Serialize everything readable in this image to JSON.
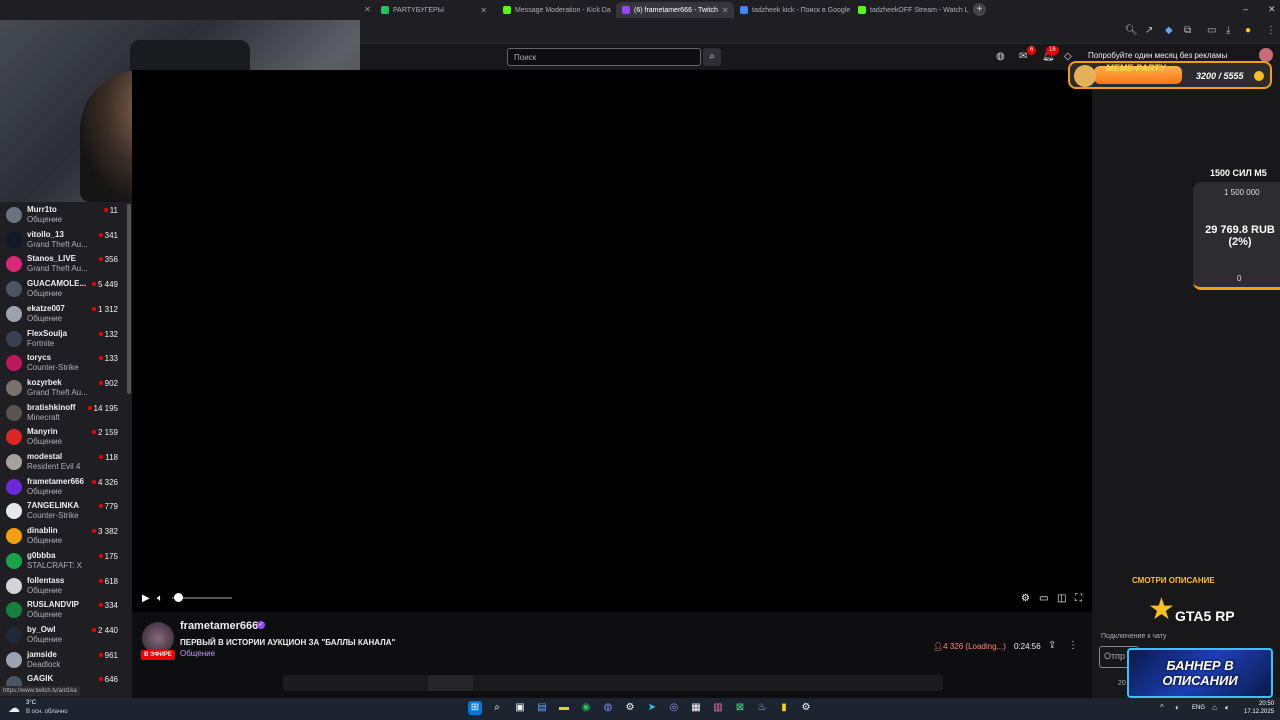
{
  "browser": {
    "tabs": [
      {
        "label": "PARTYБУГЕРЫ",
        "color": "#22c55e"
      },
      {
        "label": "Message Moderation - Kick Da",
        "color": "#53fc18"
      },
      {
        "label": "(6) frametamer666 - Twitch",
        "color": "#9147ff",
        "active": true
      },
      {
        "label": "tadzheek kick - Поиск в Google",
        "color": "#4285f4"
      },
      {
        "label": "tadzheekOFF Stream - Watch L",
        "color": "#53fc18"
      }
    ],
    "new_tab": "+",
    "status_url": "https://www.twitch.tv/ant1ka"
  },
  "twitch": {
    "search_placeholder": "Поиск",
    "notif_inbox_count": "6",
    "notif_count": "16",
    "prime_text": "Попробуйте один месяц без рекламы"
  },
  "sidebar": {
    "channels": [
      {
        "name": "Murr1to",
        "game": "Общение",
        "viewers": "11",
        "color": "#6b7280"
      },
      {
        "name": "vitollo_13",
        "game": "Grand Theft Au...",
        "viewers": "341",
        "color": "#111827"
      },
      {
        "name": "Stanos_LIVE",
        "game": "Grand Theft Au...",
        "viewers": "356",
        "color": "#db2777"
      },
      {
        "name": "GUACAMOLE...",
        "game": "Общение",
        "viewers": "5 449",
        "color": "#4b5563"
      },
      {
        "name": "ekatze007",
        "game": "Общение",
        "viewers": "1 312",
        "color": "#9ca3af"
      },
      {
        "name": "FlexSoulja",
        "game": "Fortnite",
        "viewers": "132",
        "color": "#374151"
      },
      {
        "name": "torycs",
        "game": "Counter-Strike",
        "viewers": "133",
        "color": "#be185d"
      },
      {
        "name": "kozyrbek",
        "game": "Grand Theft Au...",
        "viewers": "902",
        "color": "#78716c"
      },
      {
        "name": "bratishkinoff",
        "game": "Minecraft",
        "viewers": "14 195",
        "color": "#57534e"
      },
      {
        "name": "Manyrin",
        "game": "Общение",
        "viewers": "2 159",
        "color": "#dc2626"
      },
      {
        "name": "modestal",
        "game": "Resident Evil 4",
        "viewers": "118",
        "color": "#a8a29e"
      },
      {
        "name": "frametamer666",
        "game": "Общение",
        "viewers": "4 326",
        "color": "#6d28d9"
      },
      {
        "name": "7ANGELINKA",
        "game": "Counter-Strike",
        "viewers": "779",
        "color": "#e5e7eb"
      },
      {
        "name": "dinablin",
        "game": "Общение",
        "viewers": "3 382",
        "color": "#f59e0b"
      },
      {
        "name": "g0bbba",
        "game": "STALCRAFT: X",
        "viewers": "175",
        "color": "#16a34a"
      },
      {
        "name": "follentass",
        "game": "Общение",
        "viewers": "618",
        "color": "#d1d5db"
      },
      {
        "name": "RUSLANDVIP",
        "game": "Общение",
        "viewers": "334",
        "color": "#15803d"
      },
      {
        "name": "by_Owl",
        "game": "Общение",
        "viewers": "2 440",
        "color": "#1f2937"
      },
      {
        "name": "jamside",
        "game": "Deadlock",
        "viewers": "961",
        "color": "#9ca3af"
      },
      {
        "name": "GAGIK",
        "game": "",
        "viewers": "646",
        "color": "#4b5563"
      }
    ]
  },
  "stream": {
    "streamer": "frametamer666",
    "live_label": "В ЭФИРЕ",
    "title": "ПЕРВЫЙ В ИСТОРИИ АУКЦИОН ЗА \"БАЛЛЫ КАНАЛА\"",
    "category": "Общение",
    "viewers": "4 326 (Loading...)",
    "uptime": "0:24:56"
  },
  "overlay": {
    "meme_label": "MEME-PARTY",
    "meme_count": "3200 / 5555",
    "goal_title": "1500 СИЛ M5",
    "goal_top": "1 500 000",
    "goal_amount": "29 769.8 RUB (2%)",
    "goal_bottom": "0",
    "desc_label": "СМОТРИ ОПИСАНИЕ",
    "gta_label": "GTA5 RP",
    "banner_text": "БАННЕР В ОПИСАНИИ"
  },
  "chat": {
    "connecting": "Подключение к чату",
    "input_placeholder": "Отпр",
    "bottom_num": "20"
  },
  "taskbar": {
    "temp": "3°C",
    "weather": "В осн. облачно",
    "lang": "ENG",
    "time": "20:50",
    "date": "17.12.2025"
  }
}
